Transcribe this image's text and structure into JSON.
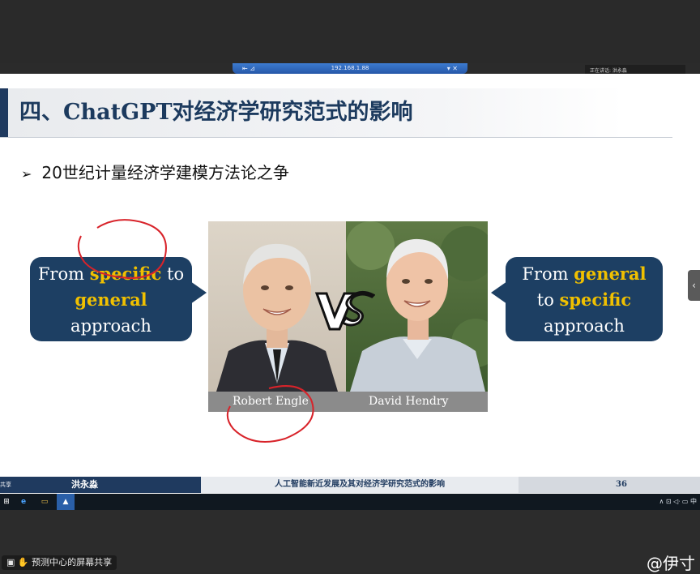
{
  "remote_bar": {
    "address": "192.168.1.88",
    "left_icons": "⇤ ⊿",
    "right_icons": "▾ ✕"
  },
  "speaker_tag": "正在讲话: 洪永淼",
  "slide": {
    "title": "四、ChatGPT对经济学研究范式的影响",
    "bullet_marker": "➢",
    "bullet": "20世纪计量经济学建模方法论之争",
    "left_bubble": {
      "line1_a": "From ",
      "line1_hl": "specific",
      "line1_b": " to",
      "line2_hl": "general",
      "line3": "approach"
    },
    "right_bubble": {
      "line1_a": "From ",
      "line1_hl": "general",
      "line2_a": "to ",
      "line2_hl": "specific",
      "line3": "approach"
    },
    "left_name": "Robert Engle",
    "right_name": "David Hendry"
  },
  "footer": {
    "left_small": "共享",
    "presenter": "洪永淼",
    "center": "人工智能新近发展及其对经济学研究范式的影响",
    "page": "36"
  },
  "taskbar": {
    "tray": "∧ ⊡ ◁ᐧ ▭ 中"
  },
  "share_label": "预测中心的屏幕共享",
  "handle": "@伊寸",
  "colors": {
    "navy": "#1d3f63",
    "highlight": "#f0c000",
    "annotation": "#d8232a"
  }
}
